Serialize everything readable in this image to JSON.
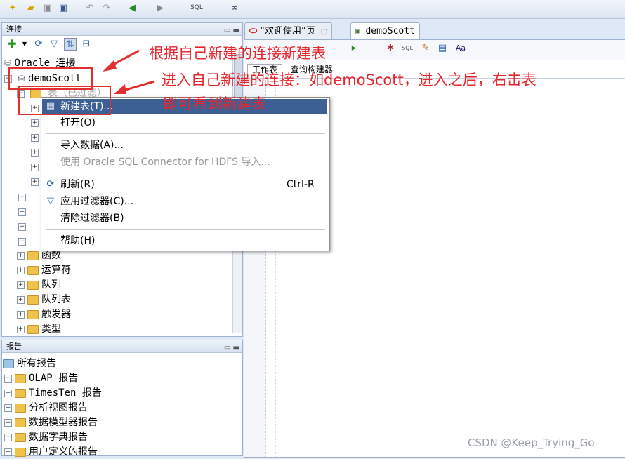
{
  "connections_panel": {
    "title": "连接",
    "root": "Oracle 连接",
    "connection": "demoScott",
    "tables_node": "表（已过滤）",
    "nodes": [
      "函数",
      "运算符",
      "队列",
      "队列表",
      "触发器",
      "类型"
    ]
  },
  "reports_panel": {
    "title": "报告",
    "root": "所有报告",
    "items": [
      "OLAP 报告",
      "TimesTen 报告",
      "分析视图报告",
      "数据模型器报告",
      "数据字典报告",
      "用户定义的报告"
    ]
  },
  "editor": {
    "tabs": [
      "“欢迎使用”页",
      "demoScott"
    ],
    "subtabs": [
      "工作表",
      "查询构建器"
    ]
  },
  "context_menu": {
    "new_table": "新建表(T)...",
    "open": "打开(O)",
    "import_data": "导入数据(A)...",
    "import_hdfs": "使用 Oracle SQL Connector for HDFS 导入...",
    "refresh": "刷新(R)",
    "refresh_shortcut": "Ctrl-R",
    "apply_filter": "应用过滤器(C)...",
    "clear_filter": "清除过滤器(B)",
    "help": "帮助(H)"
  },
  "annotations": {
    "a1": "根据自己新建的连接新建表",
    "a2": "进入自己新建的连接：如demoScott，进入之后，右击表",
    "a3": "即可看到新建表"
  },
  "watermark": "CSDN @Keep_Trying_Go",
  "colors": {
    "highlight": "#3c5f94",
    "annotation": "#e8262d",
    "accent_red": "#e03030"
  }
}
